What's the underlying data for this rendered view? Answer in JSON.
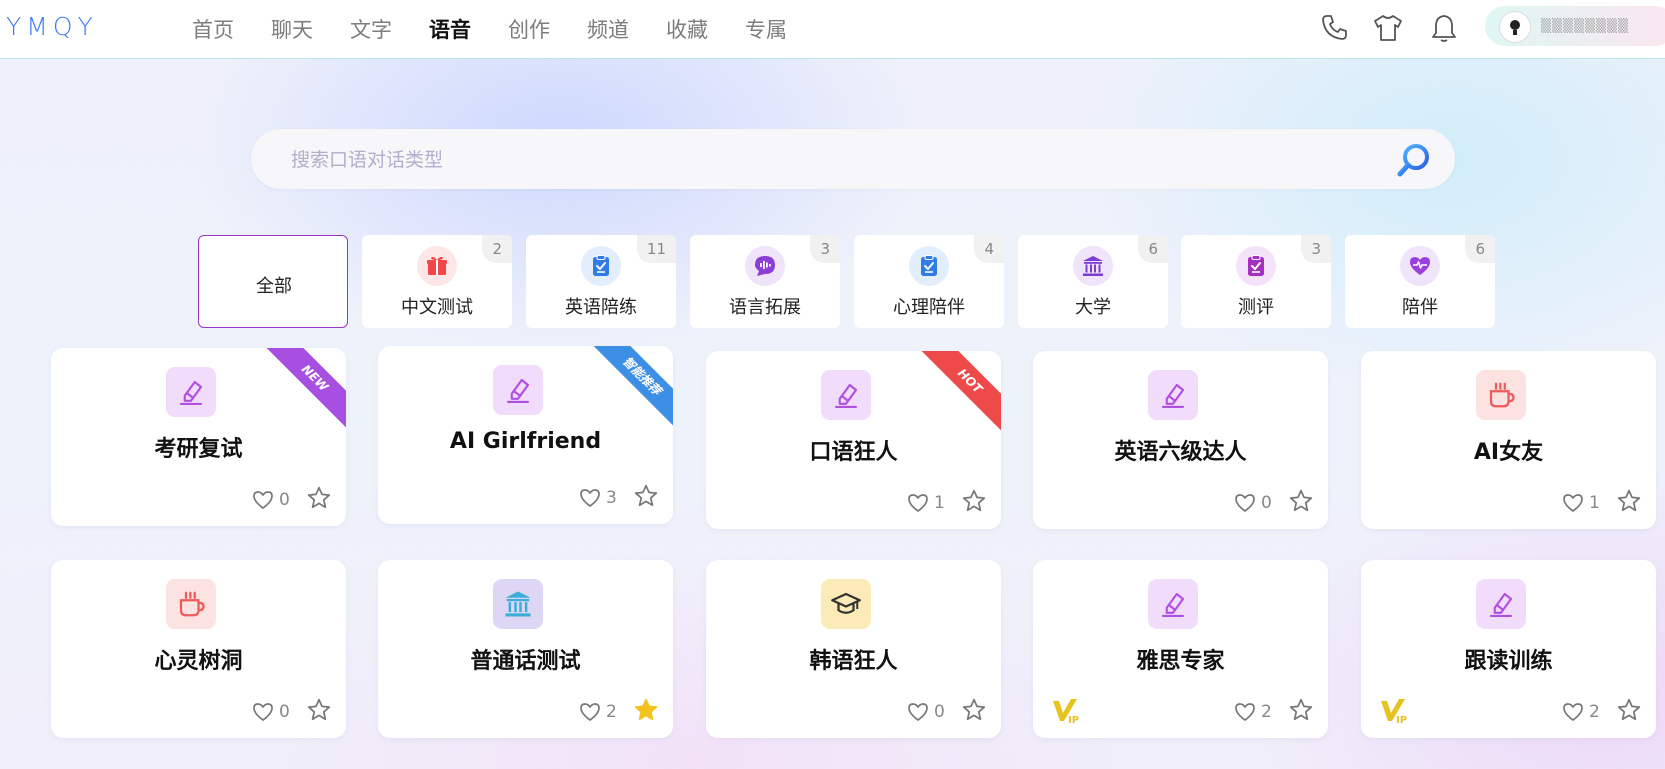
{
  "brand": {
    "logo": "YMQY"
  },
  "nav": {
    "items": [
      {
        "label": "首页",
        "active": false
      },
      {
        "label": "聊天",
        "active": false
      },
      {
        "label": "文字",
        "active": false
      },
      {
        "label": "语音",
        "active": true
      },
      {
        "label": "创作",
        "active": false
      },
      {
        "label": "频道",
        "active": false
      },
      {
        "label": "收藏",
        "active": false
      },
      {
        "label": "专属",
        "active": false
      }
    ]
  },
  "header_icons": [
    "phone-icon",
    "shirt-icon",
    "bell-icon"
  ],
  "user": {
    "name": "▒▒▒▒▒▒▒▒"
  },
  "search": {
    "placeholder": "搜索口语对话类型",
    "value": ""
  },
  "categories": [
    {
      "label": "全部",
      "count": "",
      "icon": "",
      "active": true
    },
    {
      "label": "中文测试",
      "count": "2",
      "icon": "gift-icon",
      "color": "#f04848",
      "bg": "#fde6e6"
    },
    {
      "label": "英语陪练",
      "count": "11",
      "icon": "clipboard-check-icon",
      "color": "#2f7be8",
      "bg": "#e2eefc"
    },
    {
      "label": "语言拓展",
      "count": "3",
      "icon": "voice-bubble-icon",
      "color": "#8b3ed6",
      "bg": "#efe4fa"
    },
    {
      "label": "心理陪伴",
      "count": "4",
      "icon": "clipboard-check-icon",
      "color": "#2f7be8",
      "bg": "#e2eefc"
    },
    {
      "label": "大学",
      "count": "6",
      "icon": "university-icon",
      "color": "#7a3ed6",
      "bg": "#efe4fa"
    },
    {
      "label": "测评",
      "count": "3",
      "icon": "clipboard-check-icon",
      "color": "#a42fc0",
      "bg": "#f4e3f8"
    },
    {
      "label": "陪伴",
      "count": "6",
      "icon": "heart-pulse-icon",
      "color": "#9a3ee0",
      "bg": "#efe4fa"
    }
  ],
  "cards": [
    {
      "title": "考研复试",
      "likes": "0",
      "icon": "pen-icon",
      "iconColor": "#b14fe3",
      "iconBg": "#f1dcfb",
      "ribbon": "NEW",
      "ribbonColor": "#a64fe0",
      "starred": false,
      "vip": false
    },
    {
      "title": "AI Girlfriend",
      "likes": "3",
      "icon": "pen-icon",
      "iconColor": "#b14fe3",
      "iconBg": "#f1dcfb",
      "ribbon": "智能推荐",
      "ribbonColor": "#3d8ee5",
      "starred": false,
      "vip": false
    },
    {
      "title": "口语狂人",
      "likes": "1",
      "icon": "pen-icon",
      "iconColor": "#b14fe3",
      "iconBg": "#f1dcfb",
      "ribbon": "HOT",
      "ribbonColor": "#ef4a4a",
      "starred": false,
      "vip": false
    },
    {
      "title": "英语六级达人",
      "likes": "0",
      "icon": "pen-icon",
      "iconColor": "#b14fe3",
      "iconBg": "#f1dcfb",
      "ribbon": "",
      "starred": false,
      "vip": false
    },
    {
      "title": "AI女友",
      "likes": "1",
      "icon": "coffee-icon",
      "iconColor": "#ef5a5a",
      "iconBg": "#fde2e2",
      "ribbon": "",
      "starred": false,
      "vip": false
    },
    {
      "title": "心灵树洞",
      "likes": "0",
      "icon": "coffee-icon",
      "iconColor": "#ef5a5a",
      "iconBg": "#fde2e2",
      "ribbon": "",
      "starred": false,
      "vip": false
    },
    {
      "title": "普通话测试",
      "likes": "2",
      "icon": "university-icon",
      "iconColor": "#3aaed9",
      "iconBg": "#ddd6f5",
      "ribbon": "",
      "starred": true,
      "vip": false
    },
    {
      "title": "韩语狂人",
      "likes": "0",
      "icon": "graduation-cap-icon",
      "iconColor": "#333333",
      "iconBg": "#fcebb6",
      "ribbon": "",
      "starred": false,
      "vip": false
    },
    {
      "title": "雅思专家",
      "likes": "2",
      "icon": "pen-icon",
      "iconColor": "#b14fe3",
      "iconBg": "#f1dcfb",
      "ribbon": "",
      "starred": false,
      "vip": true
    },
    {
      "title": "跟读训练",
      "likes": "2",
      "icon": "pen-icon",
      "iconColor": "#b14fe3",
      "iconBg": "#f1dcfb",
      "ribbon": "",
      "starred": false,
      "vip": true
    }
  ],
  "vip_label": "VIP"
}
